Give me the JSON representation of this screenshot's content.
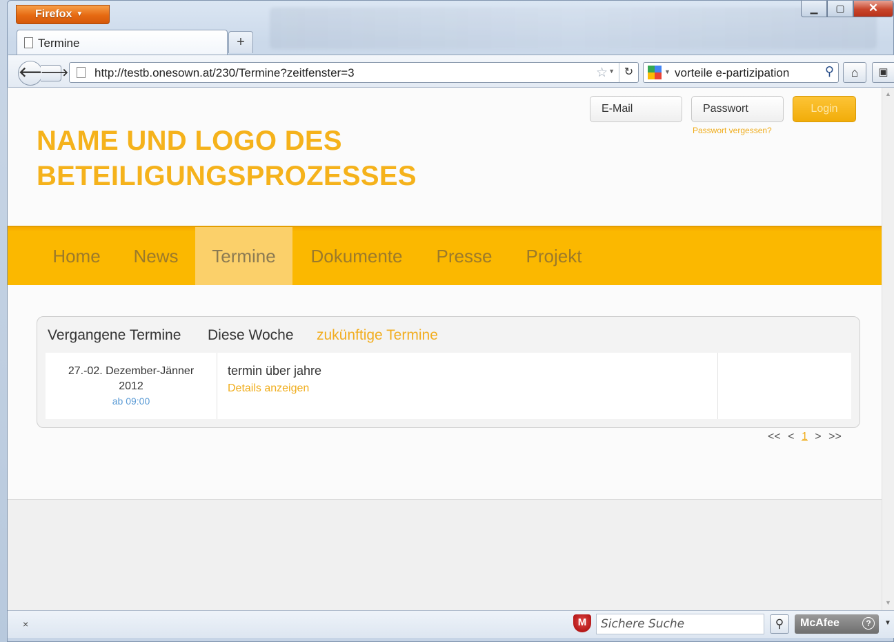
{
  "browser": {
    "app_button": "Firefox",
    "tab_title": "Termine",
    "new_tab": "+",
    "url": "http://testb.onesown.at/230/Termine?zeitfenster=3",
    "search_value": "vorteile e-partizipation",
    "status_close": "×",
    "safe_search_placeholder": "Sichere Suche",
    "mcafee_label": "McAfee"
  },
  "site": {
    "title_line1": "NAME UND LOGO DES",
    "title_line2": "BETEILIGUNGSPROZESSES",
    "login": {
      "email_placeholder": "E-Mail",
      "password_placeholder": "Passwort",
      "button": "Login",
      "forgot": "Passwort vergessen?"
    },
    "nav": [
      {
        "label": "Home",
        "active": false
      },
      {
        "label": "News",
        "active": false
      },
      {
        "label": "Termine",
        "active": true
      },
      {
        "label": "Dokumente",
        "active": false
      },
      {
        "label": "Presse",
        "active": false
      },
      {
        "label": "Projekt",
        "active": false
      }
    ],
    "events": {
      "tabs": [
        {
          "label": "Vergangene Termine",
          "active": false
        },
        {
          "label": "Diese Woche",
          "active": false
        },
        {
          "label": "zukünftige Termine",
          "active": true
        }
      ],
      "rows": [
        {
          "date": "27.-02. Dezember-Jänner",
          "year": "2012",
          "time": "ab 09:00",
          "title": "termin über jahre",
          "link": "Details anzeigen"
        }
      ],
      "pager": {
        "first": "<<",
        "prev": "<",
        "current": "1",
        "next": ">",
        "last": ">>"
      }
    }
  },
  "colors": {
    "accent": "#fbb800",
    "title": "#f5b21b",
    "link": "#f0ad1c"
  }
}
